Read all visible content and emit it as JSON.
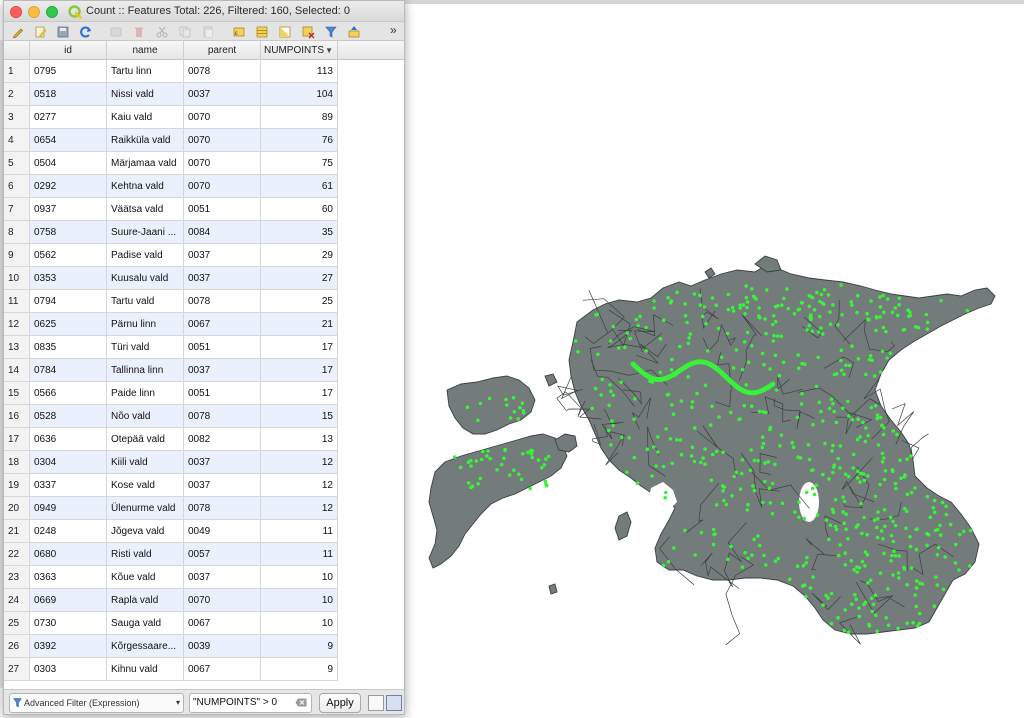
{
  "window": {
    "title": "Count :: Features Total: 226, Filtered: 160, Selected: 0"
  },
  "toolbar": {
    "icons": [
      "pencil-icon",
      "multi-edit-icon",
      "save-icon",
      "reload-icon",
      "add-feature-icon",
      "delete-icon",
      "cut-icon",
      "copy-icon",
      "paste-icon",
      "select-by-expression-icon",
      "select-all-icon",
      "invert-selection-icon",
      "deselect-icon",
      "filter-icon",
      "move-to-top-icon",
      "more-icon"
    ],
    "more_label": "»"
  },
  "table": {
    "columns": [
      {
        "key": "id",
        "label": "id"
      },
      {
        "key": "name",
        "label": "name"
      },
      {
        "key": "parent",
        "label": "parent"
      },
      {
        "key": "numpoints",
        "label": "NUMPOINTS",
        "sort": "▼"
      }
    ],
    "rows": [
      {
        "n": "1",
        "id": "0795",
        "name": "Tartu linn",
        "parent": "0078",
        "np": "113"
      },
      {
        "n": "2",
        "id": "0518",
        "name": "Nissi vald",
        "parent": "0037",
        "np": "104"
      },
      {
        "n": "3",
        "id": "0277",
        "name": "Kaiu vald",
        "parent": "0070",
        "np": "89"
      },
      {
        "n": "4",
        "id": "0654",
        "name": "Raikküla vald",
        "parent": "0070",
        "np": "76"
      },
      {
        "n": "5",
        "id": "0504",
        "name": "Märjamaa vald",
        "parent": "0070",
        "np": "75"
      },
      {
        "n": "6",
        "id": "0292",
        "name": "Kehtna vald",
        "parent": "0070",
        "np": "61"
      },
      {
        "n": "7",
        "id": "0937",
        "name": "Väätsa vald",
        "parent": "0051",
        "np": "60"
      },
      {
        "n": "8",
        "id": "0758",
        "name": "Suure-Jaani ...",
        "parent": "0084",
        "np": "35"
      },
      {
        "n": "9",
        "id": "0562",
        "name": "Padise vald",
        "parent": "0037",
        "np": "29"
      },
      {
        "n": "10",
        "id": "0353",
        "name": "Kuusalu vald",
        "parent": "0037",
        "np": "27"
      },
      {
        "n": "11",
        "id": "0794",
        "name": "Tartu vald",
        "parent": "0078",
        "np": "25"
      },
      {
        "n": "12",
        "id": "0625",
        "name": "Pärnu linn",
        "parent": "0067",
        "np": "21"
      },
      {
        "n": "13",
        "id": "0835",
        "name": "Türi vald",
        "parent": "0051",
        "np": "17"
      },
      {
        "n": "14",
        "id": "0784",
        "name": "Tallinna linn",
        "parent": "0037",
        "np": "17"
      },
      {
        "n": "15",
        "id": "0566",
        "name": "Paide linn",
        "parent": "0051",
        "np": "17"
      },
      {
        "n": "16",
        "id": "0528",
        "name": "Nõo vald",
        "parent": "0078",
        "np": "15"
      },
      {
        "n": "17",
        "id": "0636",
        "name": "Otepää vald",
        "parent": "0082",
        "np": "13"
      },
      {
        "n": "18",
        "id": "0304",
        "name": "Kiili vald",
        "parent": "0037",
        "np": "12"
      },
      {
        "n": "19",
        "id": "0337",
        "name": "Kose vald",
        "parent": "0037",
        "np": "12"
      },
      {
        "n": "20",
        "id": "0949",
        "name": "Ülenurme vald",
        "parent": "0078",
        "np": "12"
      },
      {
        "n": "21",
        "id": "0248",
        "name": "Jõgeva vald",
        "parent": "0049",
        "np": "11"
      },
      {
        "n": "22",
        "id": "0680",
        "name": "Risti vald",
        "parent": "0057",
        "np": "11"
      },
      {
        "n": "23",
        "id": "0363",
        "name": "Kõue vald",
        "parent": "0037",
        "np": "10"
      },
      {
        "n": "24",
        "id": "0669",
        "name": "Rapla vald",
        "parent": "0070",
        "np": "10"
      },
      {
        "n": "25",
        "id": "0730",
        "name": "Sauga vald",
        "parent": "0067",
        "np": "10"
      },
      {
        "n": "26",
        "id": "0392",
        "name": "Kõrgessaare...",
        "parent": "0039",
        "np": "9"
      },
      {
        "n": "27",
        "id": "0303",
        "name": "Kihnu vald",
        "parent": "0067",
        "np": "9"
      }
    ]
  },
  "bottom": {
    "filter_mode": "Advanced Filter (Expression)",
    "expression": "\"NUMPOINTS\" > 0",
    "apply_label": "Apply"
  },
  "map": {
    "land_color": "#737b7b",
    "border_color": "#3b4040",
    "point_color": "#39f23a",
    "background": "#ffffff"
  }
}
